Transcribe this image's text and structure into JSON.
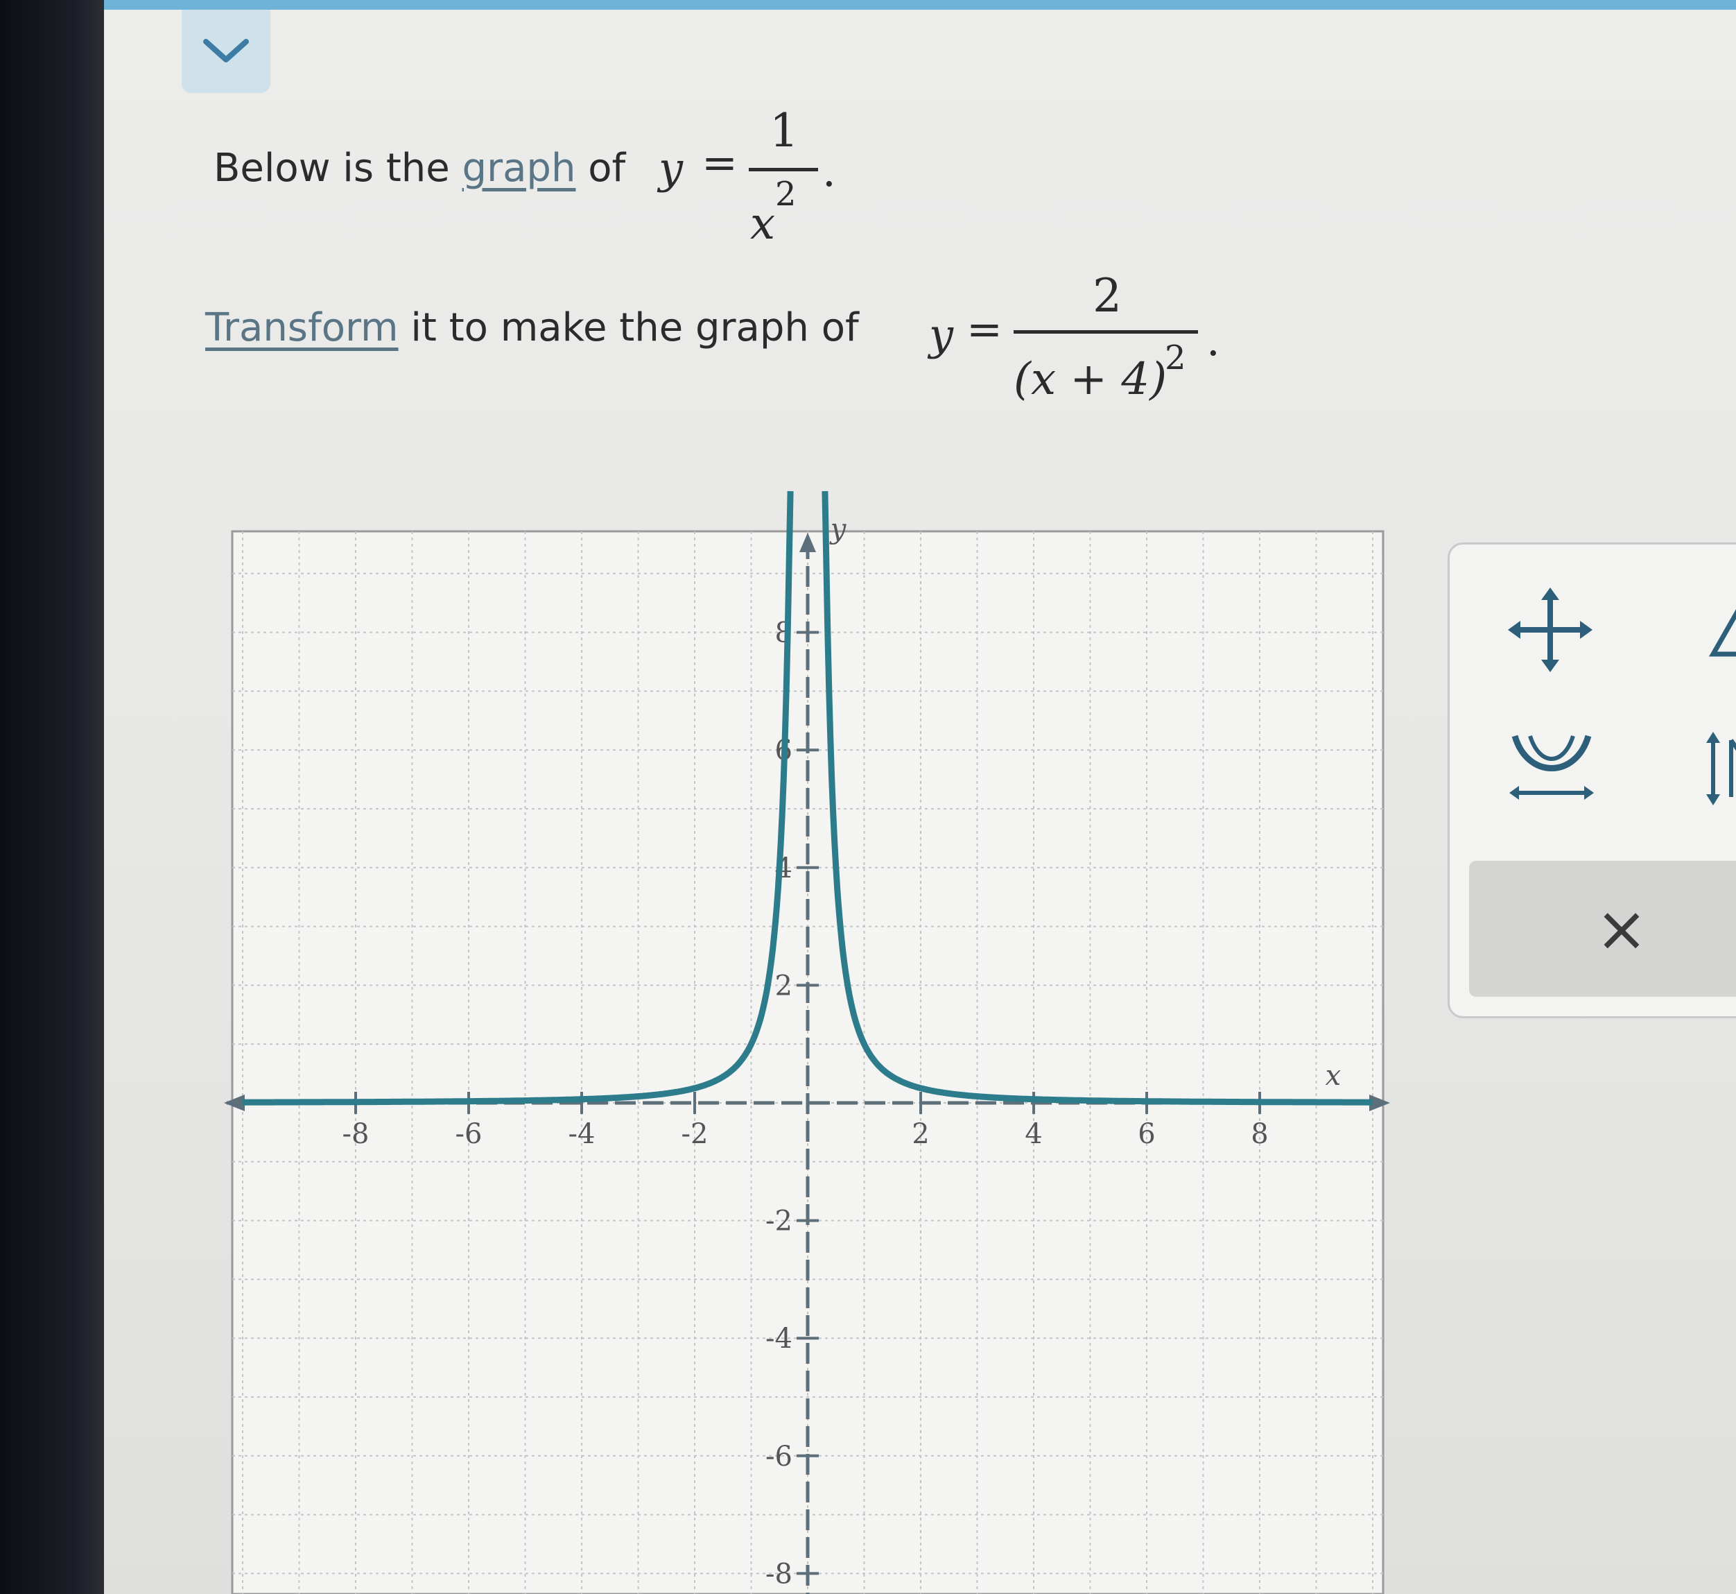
{
  "prompt": {
    "line1_before": "Below is the",
    "line1_link": "graph",
    "line1_after": "of",
    "line1_y": "y",
    "line1_eq": "=",
    "line1_numerator": "1",
    "line1_denominator_var": "x",
    "line1_denominator_exp": "2",
    "line1_period": ".",
    "line2_link": "Transform",
    "line2_after": "it to make the graph of",
    "line2_y": "y",
    "line2_eq": "=",
    "line2_numerator": "2",
    "line2_denominator": "(x + 4)",
    "line2_denominator_exp": "2",
    "line2_period": "."
  },
  "toolbar": {
    "clear_label": "×",
    "tools": [
      "move-icon",
      "vertical-stretch-icon",
      "horizontal-stretch-icon",
      "vertical-flip-icon"
    ]
  },
  "colors": {
    "curve": "#2d7c8c",
    "axis": "#5c6f7a",
    "grid": "#c4c4c4",
    "tab": "#cfe1ea"
  },
  "chart_data": {
    "type": "line",
    "function": "y = 1/x^2",
    "xlabel": "x",
    "ylabel": "y",
    "xlim": [
      -10,
      10
    ],
    "ylim": [
      -8,
      10
    ],
    "grid": true,
    "x_tick_labels": [
      "-8",
      "-6",
      "-4",
      "-2",
      "2",
      "4",
      "6",
      "8"
    ],
    "y_tick_labels": [
      "8",
      "6",
      "4",
      "2",
      "-2",
      "-4",
      "-6",
      "-8"
    ],
    "series": [
      {
        "x": [
          -10,
          -8,
          -6,
          -4,
          -3,
          -2,
          -1.5,
          -1,
          -0.75,
          -0.5,
          -0.4,
          -0.33,
          0.33,
          0.4,
          0.5,
          0.75,
          1,
          1.5,
          2,
          3,
          4,
          6,
          8,
          10
        ],
        "y": [
          0.01,
          0.016,
          0.028,
          0.063,
          0.11,
          0.25,
          0.44,
          1,
          1.78,
          4,
          6.25,
          9.2,
          9.2,
          6.25,
          4,
          1.78,
          1,
          0.44,
          0.25,
          0.11,
          0.063,
          0.028,
          0.016,
          0.01
        ]
      }
    ]
  }
}
